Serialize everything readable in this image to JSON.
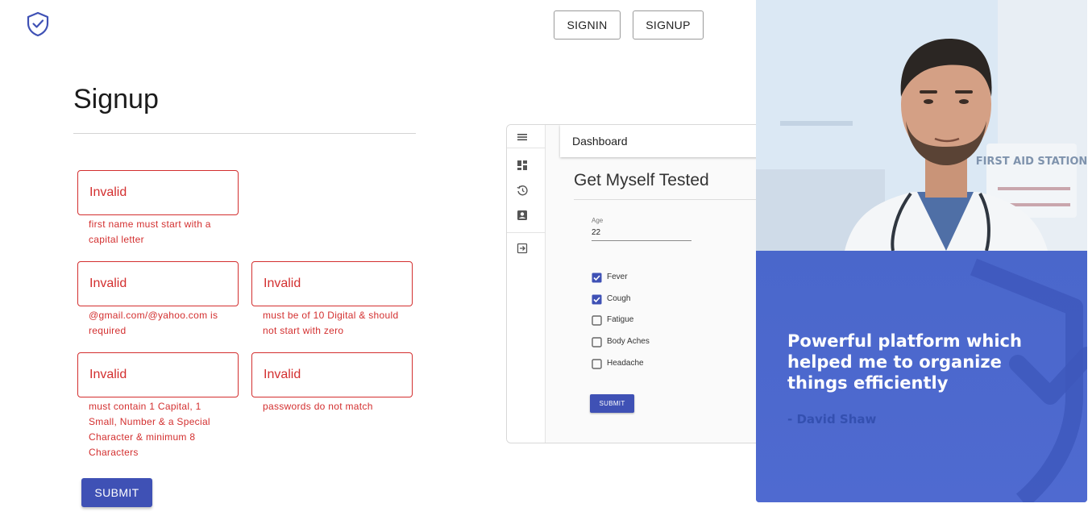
{
  "nav": {
    "signin_label": "SIGNIN",
    "signup_label": "SIGNUP"
  },
  "form": {
    "title": "Signup",
    "fields": [
      {
        "name": "first-name",
        "value": "Invalid",
        "error": "first name must start with a capital letter"
      },
      {
        "name": "email",
        "value": "Invalid",
        "error": "@gmail.com/@yahoo.com is required"
      },
      {
        "name": "phone",
        "value": "Invalid",
        "error": "must be of 10 Digital & should not start with zero"
      },
      {
        "name": "password",
        "value": "Invalid",
        "error": "must contain 1 Capital, 1 Small, Number & a Special Character & minimum 8 Characters"
      },
      {
        "name": "confirm-password",
        "value": "Invalid",
        "error": "passwords do not match"
      }
    ],
    "submit_label": "SUBMIT"
  },
  "preview": {
    "appbar_title": "Dashboard",
    "page_title": "Get Myself Tested",
    "age_label": "Age",
    "age_value": "22",
    "symptoms": [
      {
        "label": "Fever",
        "checked": true
      },
      {
        "label": "Cough",
        "checked": true
      },
      {
        "label": "Fatigue",
        "checked": false
      },
      {
        "label": "Body Aches",
        "checked": false
      },
      {
        "label": "Headache",
        "checked": false
      }
    ],
    "submit_label": "SUBMIT",
    "sidebar_icons": [
      "menu-icon",
      "dashboard-icon",
      "history-icon",
      "account-box-icon",
      "exit-icon"
    ]
  },
  "testimonial": {
    "sign_text": "FIRST AID STATION",
    "quote": "Powerful platform which helped me to organize things efficiently",
    "author": "- David Shaw"
  },
  "colors": {
    "primary": "#3f51b5",
    "error": "#d32f2f",
    "card_blue": "#4a66c9"
  }
}
